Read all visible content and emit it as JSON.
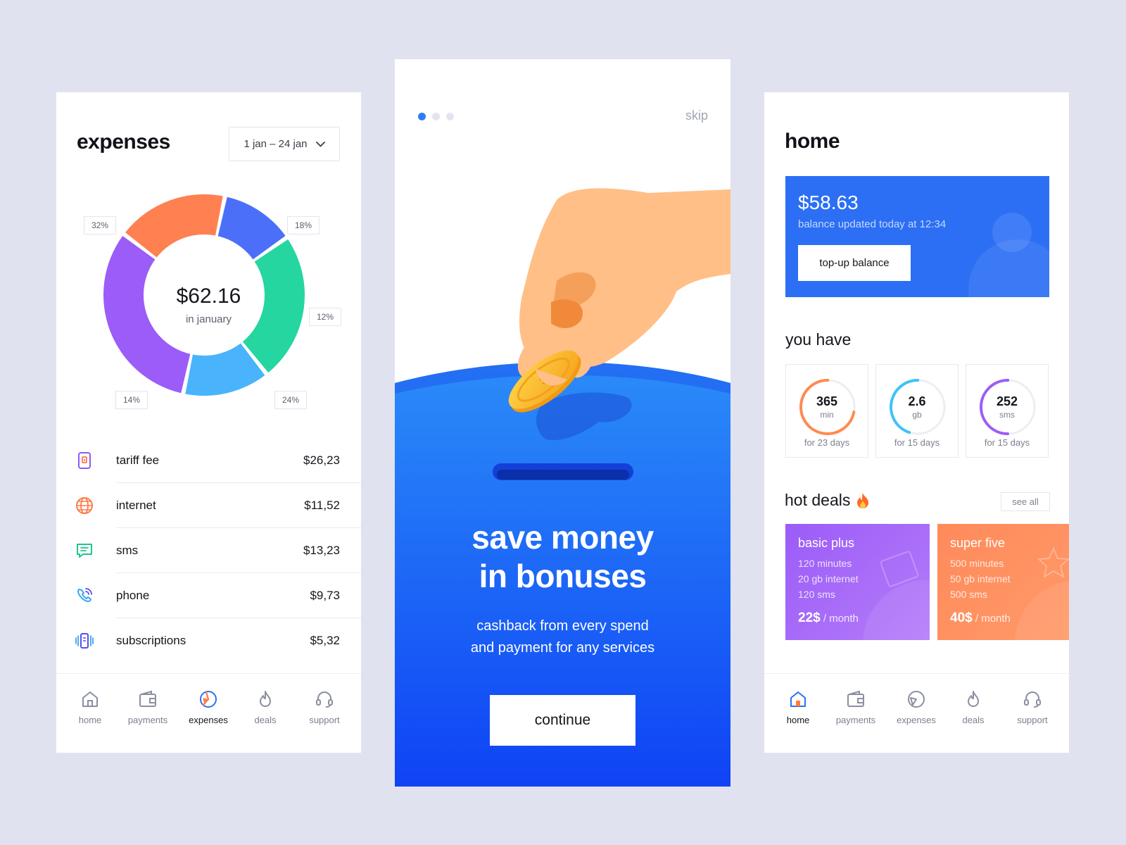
{
  "expenses": {
    "title": "expenses",
    "date_range": "1 jan – 24 jan",
    "total": "$62.16",
    "total_sub": "in january",
    "percent_labels": [
      "32%",
      "18%",
      "12%",
      "24%",
      "14%"
    ],
    "segment_colors": [
      "#9b5cf8",
      "#ff8050",
      "#4b6ff8",
      "#25d6a0",
      "#49b4fb"
    ],
    "items": [
      {
        "name": "tariff fee",
        "amount": "$26,23",
        "icon": "sim-card-icon",
        "color": "#8a5cf6"
      },
      {
        "name": "internet",
        "amount": "$11,52",
        "icon": "globe-icon",
        "color": "#ff7a45"
      },
      {
        "name": "sms",
        "amount": "$13,23",
        "icon": "message-icon",
        "color": "#1fc48f"
      },
      {
        "name": "phone",
        "amount": "$9,73",
        "icon": "phone-signal-icon",
        "color": "#3aa6f5"
      },
      {
        "name": "subscriptions",
        "amount": "$5,32",
        "icon": "subscription-icon",
        "color": "#5a4cf0"
      }
    ],
    "nav": [
      "home",
      "payments",
      "expenses",
      "deals",
      "support"
    ],
    "nav_active": "expenses"
  },
  "onboarding": {
    "skip": "skip",
    "title_line1": "save money",
    "title_line2": "in bonuses",
    "subtitle_line1": "cashback from every spend",
    "subtitle_line2": "and payment for any services",
    "continue": "continue",
    "dots_total": 3,
    "dot_active": 1
  },
  "home": {
    "title": "home",
    "balance": "$58.63",
    "balance_updated": "balance updated today at 12:34",
    "topup": "top-up balance",
    "you_have_title": "you have",
    "usage": [
      {
        "value": "365",
        "unit": "min",
        "note": "for 23 days",
        "color": "#ff8a50",
        "fraction": 0.72
      },
      {
        "value": "2.6",
        "unit": "gb",
        "note": "for 15 days",
        "color": "#3ec3f7",
        "fraction": 0.45
      },
      {
        "value": "252",
        "unit": "sms",
        "note": "for 15 days",
        "color": "#9d5cf7",
        "fraction": 0.5
      }
    ],
    "hot_deals_title": "hot deals",
    "see_all": "see all",
    "deals": [
      {
        "name": "basic plus",
        "lines": [
          "120 minutes",
          "20 gb internet",
          "120 sms"
        ],
        "price": "22$",
        "period": "/ month",
        "color": "#9b5cf8"
      },
      {
        "name": "super five",
        "lines": [
          "500 minutes",
          "50 gb internet",
          "500 sms"
        ],
        "price": "40$",
        "period": "/ month",
        "color": "#ff8a5a"
      }
    ],
    "nav": [
      "home",
      "payments",
      "expenses",
      "deals",
      "support"
    ],
    "nav_active": "home"
  }
}
